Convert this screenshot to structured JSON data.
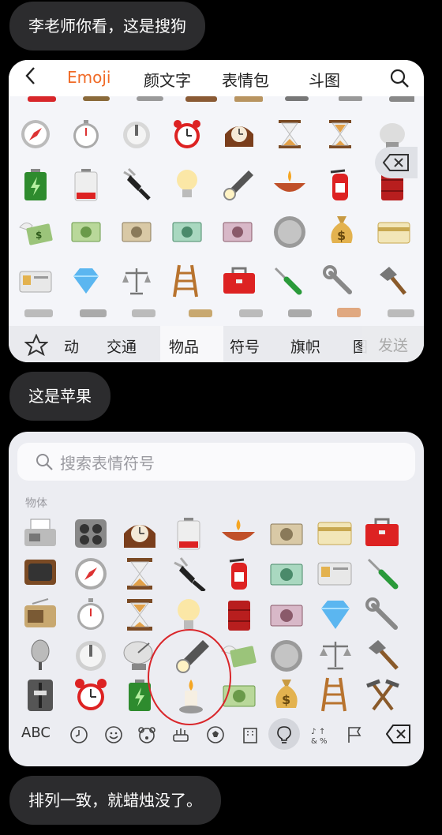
{
  "messages": [
    "李老师你看，这是搜狗",
    "这是苹果",
    "排列一致，就蜡烛没了。"
  ],
  "sogou": {
    "top_tabs": [
      "Emoji",
      "颜文字",
      "表情包",
      "斗图"
    ],
    "active_tab": "Emoji",
    "accent_color": "#f06a26",
    "categories": [
      "动",
      "交通",
      "物品",
      "符号",
      "旗帜",
      "图"
    ],
    "active_category": "物品",
    "send_label": "发送",
    "emoji_rows": [
      [
        "compass",
        "stopwatch",
        "timer",
        "alarm-clock",
        "mantel-clock",
        "hourglass",
        "hourglass-flowing",
        "satellite"
      ],
      [
        "battery",
        "low-battery",
        "plug",
        "light-bulb",
        "flashlight",
        "diya-lamp",
        "fire-extinguisher",
        "oil-drum"
      ],
      [
        "money-wings",
        "dollar",
        "yen",
        "euro",
        "pound",
        "coin",
        "money-bag",
        "credit-card"
      ],
      [
        "id-card",
        "gem",
        "balance-scale",
        "ladder",
        "toolbox",
        "screwdriver",
        "wrench",
        "hammer"
      ]
    ]
  },
  "apple": {
    "search_placeholder": "搜索表情符号",
    "section_label": "物体",
    "abc_label": "ABC",
    "emoji_columns": [
      [
        "fax",
        "tv",
        "radio",
        "microphone",
        "control-knobs"
      ],
      [
        "control-knobs-2",
        "compass",
        "stopwatch",
        "timer",
        "alarm-clock"
      ],
      [
        "mantel-clock",
        "hourglass",
        "hourglass-flowing",
        "satellite",
        "battery"
      ],
      [
        "low-battery",
        "plug",
        "light-bulb",
        "flashlight",
        "candle"
      ],
      [
        "diya-lamp",
        "fire-extinguisher",
        "oil-drum",
        "money-wings",
        "dollar"
      ],
      [
        "yen",
        "euro",
        "pound",
        "coin",
        "money-bag"
      ],
      [
        "credit-card",
        "id-card",
        "gem",
        "balance-scale",
        "ladder"
      ],
      [
        "toolbox",
        "screwdriver",
        "wrench",
        "hammer",
        "hammer-pick"
      ]
    ],
    "highlighted_emoji": "flashlight-candle",
    "bar_icons": [
      "clock-icon",
      "smiley-icon",
      "bear-icon",
      "food-icon",
      "ball-icon",
      "building-icon",
      "bulb-icon",
      "symbols-icon",
      "flag-icon",
      "delete-icon"
    ],
    "active_bar_icon": "bulb-icon",
    "circle_color": "#d9262a"
  }
}
